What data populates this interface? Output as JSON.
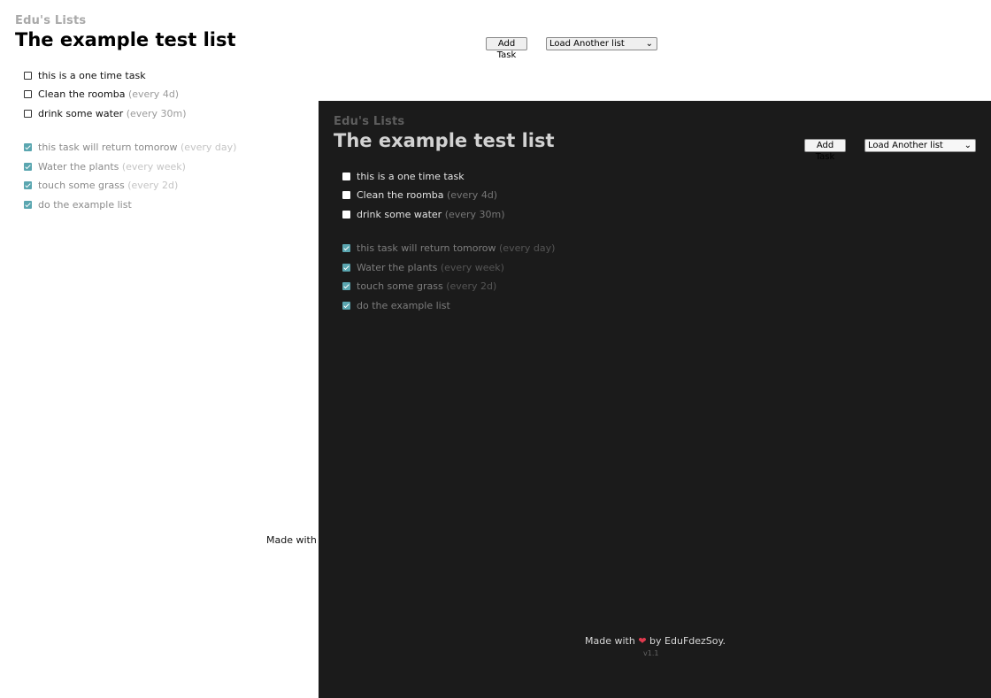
{
  "brand": "Edu's Lists",
  "list_title": "The example test list",
  "add_task_label": "Add Task",
  "select_value": "Load Another list",
  "pending_tasks": [
    {
      "name": "this is a one time task",
      "freq": ""
    },
    {
      "name": "Clean the roomba",
      "freq": "(every 4d)"
    },
    {
      "name": "drink some water",
      "freq": "(every 30m)"
    }
  ],
  "done_tasks": [
    {
      "name": "this task will return tomorow",
      "freq": "(every day)"
    },
    {
      "name": "Water the plants",
      "freq": "(every week)"
    },
    {
      "name": "touch some grass",
      "freq": "(every 2d)"
    },
    {
      "name": "do the example list",
      "freq": ""
    }
  ],
  "footer": {
    "made_with": "Made with",
    "by": "by EduFdezSoy.",
    "version": "v1.1"
  },
  "colors": {
    "accent": "#5aa6b0",
    "dark_bg": "#1b1b1b",
    "heart": "#e03a4e"
  },
  "icons": {
    "heart": "heart-icon",
    "chevron": "chevron-down-icon",
    "checkbox": "checkbox-icon"
  }
}
